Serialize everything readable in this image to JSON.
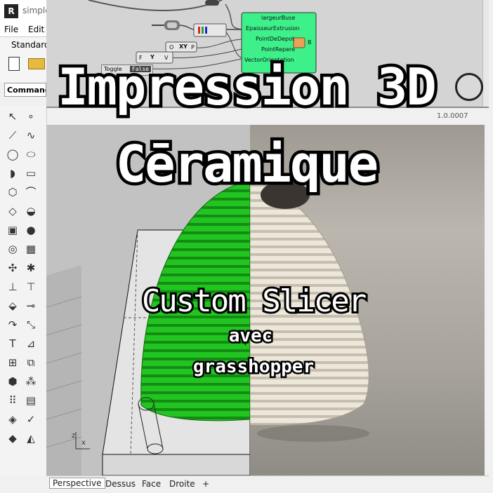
{
  "window": {
    "title": "simple",
    "logo": "rhino-logo"
  },
  "menubar": {
    "file": "File",
    "edit": "Edit"
  },
  "toolbar": {
    "tab": "Standard"
  },
  "command": {
    "label": "Command"
  },
  "sidebar": {
    "tools": [
      {
        "name": "select-arrow-icon",
        "glyph": "↖"
      },
      {
        "name": "point-icon",
        "glyph": "∘"
      },
      {
        "name": "polyline-icon",
        "glyph": "⟋"
      },
      {
        "name": "curve-icon",
        "glyph": "∿"
      },
      {
        "name": "circle-icon",
        "glyph": "◯"
      },
      {
        "name": "ellipse-icon",
        "glyph": "⬭"
      },
      {
        "name": "arc-icon",
        "glyph": "◗"
      },
      {
        "name": "rectangle-icon",
        "glyph": "▭"
      },
      {
        "name": "polygon-icon",
        "glyph": "⬡"
      },
      {
        "name": "fillet-icon",
        "glyph": "⌒"
      },
      {
        "name": "surface-icon",
        "glyph": "◇"
      },
      {
        "name": "revolve-icon",
        "glyph": "◒"
      },
      {
        "name": "box-icon",
        "glyph": "▣"
      },
      {
        "name": "sphere-icon",
        "glyph": "●"
      },
      {
        "name": "cylinder-icon",
        "glyph": "◎"
      },
      {
        "name": "mesh-icon",
        "glyph": "▦"
      },
      {
        "name": "boolean-icon",
        "glyph": "✣"
      },
      {
        "name": "explode-icon",
        "glyph": "✱"
      },
      {
        "name": "trim-icon",
        "glyph": "⊥"
      },
      {
        "name": "split-icon",
        "glyph": "⊤"
      },
      {
        "name": "group-icon",
        "glyph": "⬙"
      },
      {
        "name": "join-icon",
        "glyph": "⊸"
      },
      {
        "name": "transform-icon",
        "glyph": "↷"
      },
      {
        "name": "scale-icon",
        "glyph": "⤡"
      },
      {
        "name": "text-icon",
        "glyph": "T"
      },
      {
        "name": "dimension-icon",
        "glyph": "⊿"
      },
      {
        "name": "array-icon",
        "glyph": "⊞"
      },
      {
        "name": "mirror-icon",
        "glyph": "⧉"
      },
      {
        "name": "render-icon",
        "glyph": "⬢"
      },
      {
        "name": "lights-icon",
        "glyph": "⁂"
      },
      {
        "name": "grid-icon",
        "glyph": "⠿"
      },
      {
        "name": "layer-icon",
        "glyph": "▤"
      },
      {
        "name": "analyze-icon",
        "glyph": "◈"
      },
      {
        "name": "check-icon",
        "glyph": "✓"
      },
      {
        "name": "material-icon",
        "glyph": "◆"
      },
      {
        "name": "paint-icon",
        "glyph": "◭"
      }
    ]
  },
  "grasshopper": {
    "inputs": [
      "largeurBuse",
      "EpaisseurExtrusion",
      "PointDeDepot",
      "PointRepere",
      "VectorOrientation"
    ],
    "output": "B",
    "toggle": {
      "name": "Toggle",
      "value": "False"
    },
    "xy_node": {
      "in": "O",
      "label": "XY",
      "out": "P"
    },
    "f_node": {
      "in": "F",
      "label": "Y",
      "out": "V"
    },
    "version": "1.0.0007"
  },
  "viewport": {
    "tabs": [
      "Perspective",
      "Dessus",
      "Face",
      "Droite"
    ],
    "add_tab": "+",
    "axis_x": "x",
    "axis_z": "z"
  },
  "overlay": {
    "line1": "Impression 3D",
    "line2": "Cēramique",
    "subtitle": "Custom Slicer",
    "avec": "avec",
    "tool": "grasshopper"
  },
  "colors": {
    "model_green": "#1fbf1f",
    "gh_component": "#3df08a",
    "background": "#c2c2c2"
  }
}
